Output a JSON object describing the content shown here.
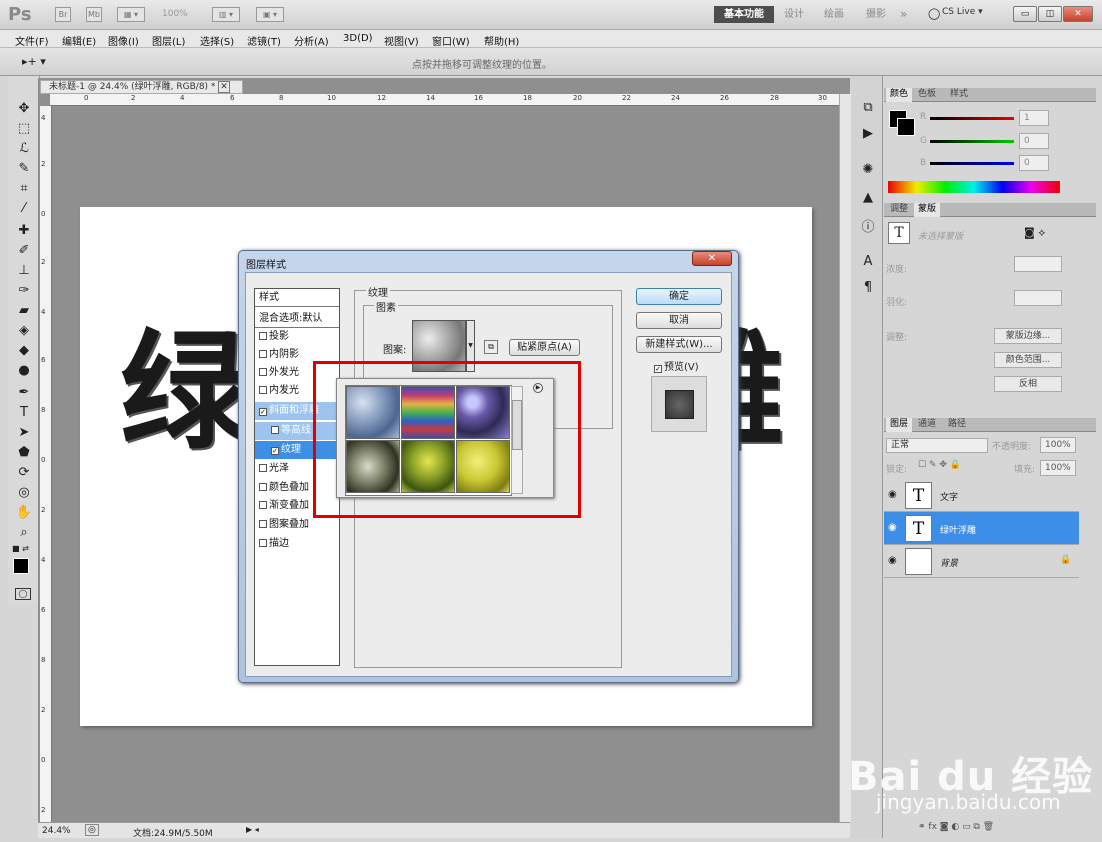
{
  "titlebar": {
    "app": "Ps",
    "br": "Br",
    "mb": "Mb",
    "zoom": "100%",
    "workspaces": [
      "基本功能",
      "设计",
      "绘画",
      "摄影"
    ],
    "more": "»",
    "cslive": "CS Live ▾"
  },
  "menus": [
    "文件(F)",
    "编辑(E)",
    "图像(I)",
    "图层(L)",
    "选择(S)",
    "滤镜(T)",
    "分析(A)",
    "3D(D)",
    "视图(V)",
    "窗口(W)",
    "帮助(H)"
  ],
  "options": {
    "hint": "点按并拖移可调整纹理的位置。"
  },
  "document": {
    "tab_title": "未标题-1 @ 24.4% (绿叶浮雕, RGB/8) *",
    "close": "✕",
    "ruler_top": [
      "0",
      "2",
      "4",
      "6",
      "8",
      "10",
      "12",
      "14",
      "16",
      "18",
      "20",
      "22",
      "24",
      "26",
      "28",
      "30"
    ],
    "ruler_left": [
      "4",
      "2",
      "0",
      "2",
      "4",
      "6",
      "8",
      "0",
      "2",
      "4",
      "6",
      "8",
      "2",
      "0",
      "2",
      "2"
    ],
    "chars": [
      "绿",
      "雕"
    ],
    "zoom": "24.4%",
    "docsize": "文档:24.9M/5.50M"
  },
  "color_panel": {
    "tabs": [
      "颜色",
      "色板",
      "样式"
    ],
    "r": "1",
    "g": "0",
    "b": "0",
    "rl": "R",
    "gl": "G",
    "bl": "B"
  },
  "adjust_panel": {
    "tabs": [
      "调整",
      "蒙版"
    ],
    "no_mask": "未选择蒙版",
    "density": "浓度:",
    "feather": "羽化:",
    "refine": "调整:",
    "btn_edge": "蒙版边缘...",
    "btn_range": "颜色范围...",
    "btn_invert": "反相"
  },
  "layers_panel": {
    "tabs": [
      "图层",
      "通道",
      "路径"
    ],
    "blend": "正常",
    "opacity_label": "不透明度:",
    "opacity": "100%",
    "lock_label": "锁定:",
    "fill_label": "填充:",
    "fill": "100%",
    "layers": [
      {
        "name": "文字",
        "thumb": "T"
      },
      {
        "name": "绿叶浮雕",
        "thumb": "T"
      },
      {
        "name": "背景",
        "thumb": ""
      }
    ]
  },
  "dialog": {
    "title": "图层样式",
    "close": "✕",
    "styles_header": "样式",
    "blend_default": "混合选项:默认",
    "styles": [
      "投影",
      "内阴影",
      "外发光",
      "内发光",
      "斜面和浮雕",
      "等高线",
      "纹理",
      "光泽",
      "颜色叠加",
      "渐变叠加",
      "图案叠加",
      "描边"
    ],
    "texture_group": "纹理",
    "pattern_group": "图素",
    "pattern_label": "图案:",
    "snap": "贴紧原点(A)",
    "ok": "确定",
    "cancel": "取消",
    "new_style": "新建样式(W)...",
    "preview": "预览(V)"
  },
  "watermark": {
    "line1": "Bai du 经验",
    "line2": "jingyan.baidu.com"
  }
}
